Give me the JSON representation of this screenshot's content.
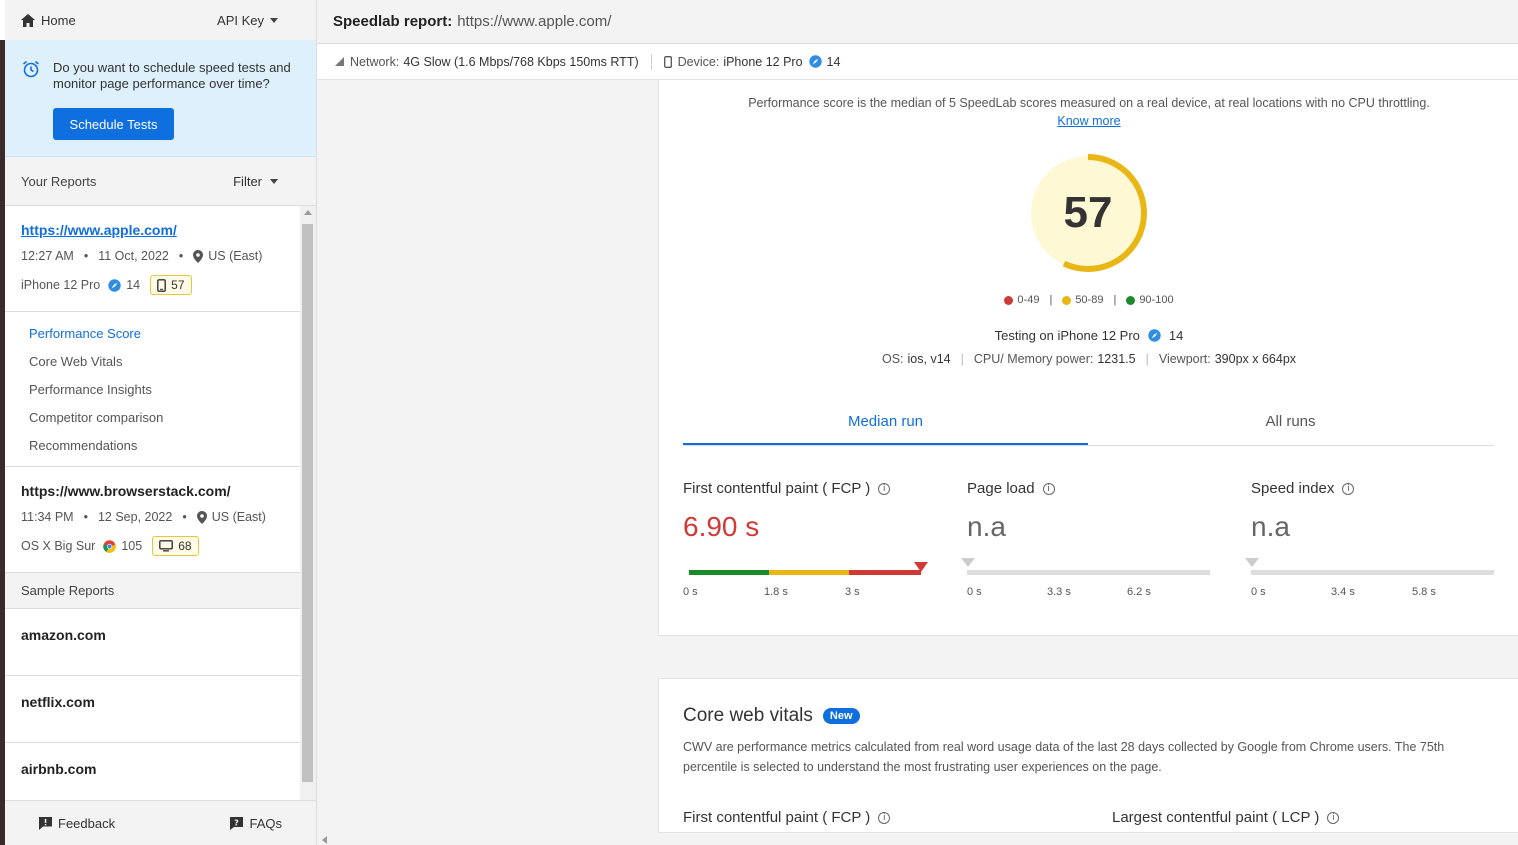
{
  "sidebar": {
    "home_label": "Home",
    "api_key_label": "API Key",
    "promo_text": "Do you want to schedule speed tests and monitor page performance over time?",
    "schedule_button": "Schedule Tests",
    "your_reports_label": "Your Reports",
    "filter_label": "Filter",
    "reports": [
      {
        "url": "https://www.apple.com/",
        "time": "12:27 AM",
        "date": "11 Oct, 2022",
        "location": "US (East)",
        "device": "iPhone 12 Pro",
        "browser_icon": "safari-icon",
        "browser_version": "14",
        "device_icon": "mobile-icon",
        "score": "57"
      },
      {
        "url": "https://www.browserstack.com/",
        "time": "11:34 PM",
        "date": "12 Sep, 2022",
        "location": "US (East)",
        "device": "OS X Big Sur",
        "browser_icon": "chrome-icon",
        "browser_version": "105",
        "device_icon": "desktop-icon",
        "score": "68"
      }
    ],
    "subnav": [
      "Performance Score",
      "Core Web Vitals",
      "Performance Insights",
      "Competitor comparison",
      "Recommendations"
    ],
    "sample_reports_label": "Sample Reports",
    "samples": [
      "amazon.com",
      "netflix.com",
      "airbnb.com"
    ],
    "feedback_label": "Feedback",
    "faqs_label": "FAQs"
  },
  "header": {
    "title_label": "Speedlab report:",
    "title_url": "https://www.apple.com/"
  },
  "network_bar": {
    "network_key": "Network:",
    "network_value": "4G Slow (1.6 Mbps/768 Kbps 150ms RTT)",
    "device_key": "Device:",
    "device_value": "iPhone 12 Pro",
    "device_version": "14"
  },
  "performance": {
    "description": "Performance score is the median of 5 SpeedLab scores measured on a real device, at real locations with no CPU throttling.",
    "know_more": "Know more",
    "score": "57",
    "score_fraction": 0.57,
    "legend": [
      {
        "label": "0-49",
        "color": "#d03a36"
      },
      {
        "label": "50-89",
        "color": "#e9b715"
      },
      {
        "label": "90-100",
        "color": "#1a8a2a"
      }
    ],
    "testing_label": "Testing on iPhone 12 Pro",
    "testing_version": "14",
    "os_key": "OS:",
    "os_value": "ios, v14",
    "cpu_key": "CPU/ Memory power:",
    "cpu_value": "1231.5",
    "viewport_key": "Viewport:",
    "viewport_value": "390px x 664px",
    "tabs": [
      "Median run",
      "All runs"
    ],
    "metrics": [
      {
        "title": "First contentful paint ( FCP )",
        "value": "6.90 s",
        "ticks": [
          "0 s",
          "1.8 s",
          "3 s"
        ]
      },
      {
        "title": "Page load",
        "value": "n.a",
        "ticks": [
          "0 s",
          "3.3 s",
          "6.2 s"
        ]
      },
      {
        "title": "Speed index",
        "value": "n.a",
        "ticks": [
          "0 s",
          "3.4 s",
          "5.8 s"
        ]
      }
    ]
  },
  "cwv": {
    "title": "Core web vitals",
    "new_badge": "New",
    "description": "CWV are performance metrics calculated from real word usage data of the last 28 days collected by Google from Chrome users. The 75th percentile is selected to understand the most frustrating user experiences on the page.",
    "metric1": "First contentful paint ( FCP )",
    "metric2": "Largest contentful paint ( LCP )"
  },
  "colors": {
    "accent": "#0f6fde",
    "good": "#1a8a2a",
    "average": "#e9b715",
    "poor": "#d03a36"
  }
}
